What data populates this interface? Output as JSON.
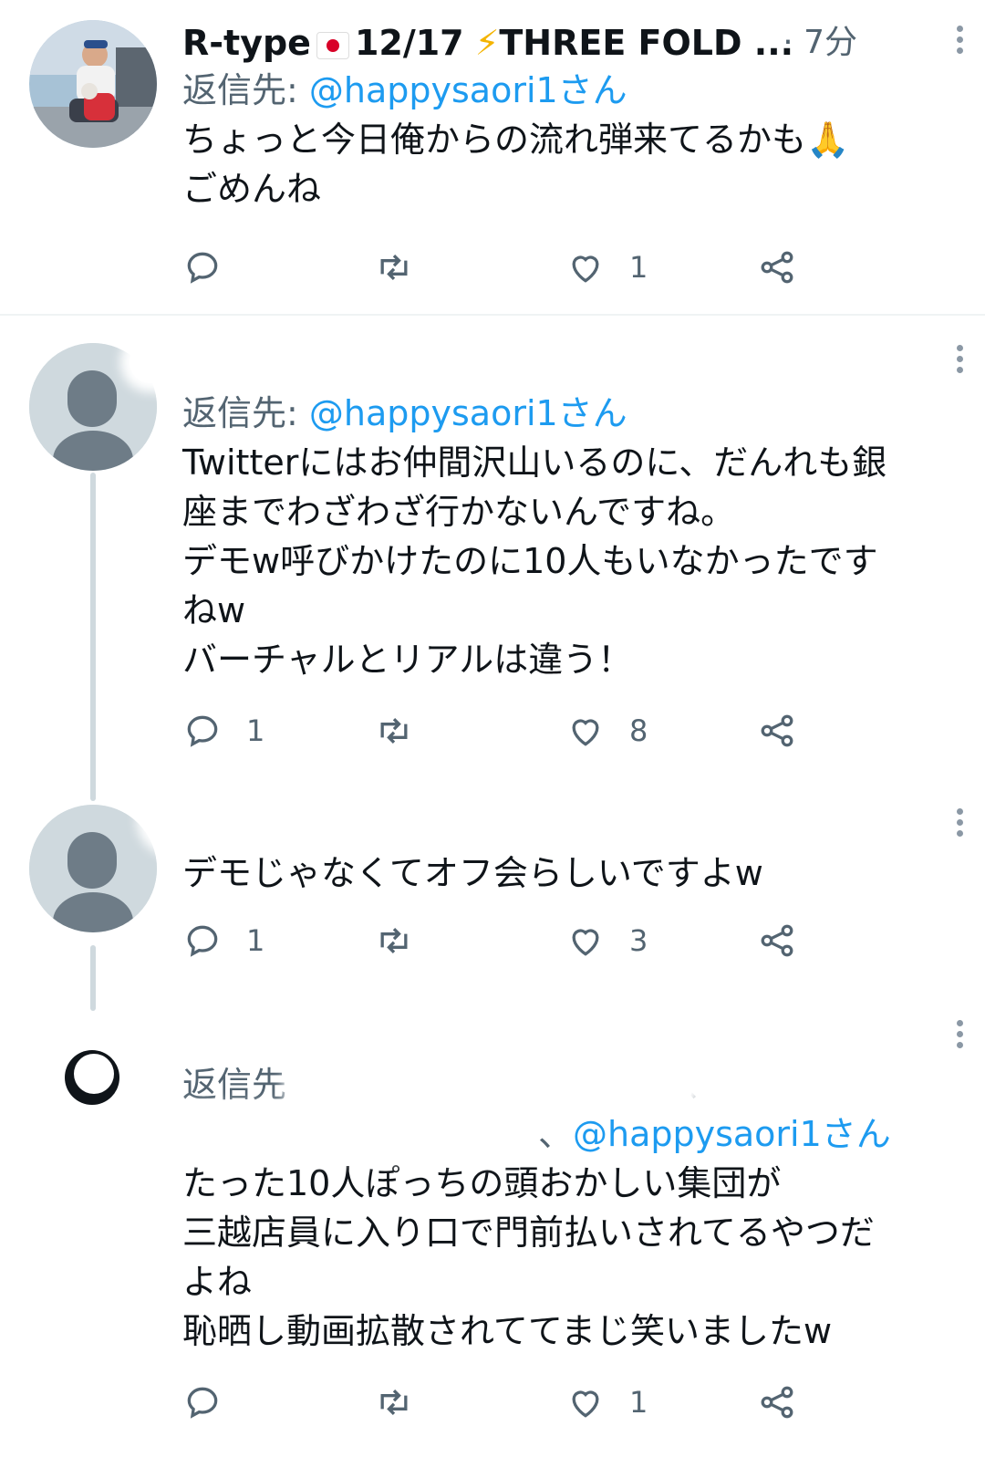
{
  "tweets": [
    {
      "name": "R-type",
      "name_suffix": "12/17",
      "name_tail": "THREE FOLD ...",
      "time": "· 7分",
      "replying_label": "返信先: ",
      "replying_to": "@happysaori1さん",
      "text": "ちょっと今日俺からの流れ弾来てるかも🙏\nごめんね",
      "reply_count": "",
      "retweet_count": "",
      "like_count": "1"
    },
    {
      "replying_label": "返信先: ",
      "replying_to": "@happysaori1さん",
      "text": "Twitterにはお仲間沢山いるのに、だんれも銀\n座までわざわざ行かないんですね。\nデモw呼びかけたのに10人もいなかったです\nねw\nバーチャルとリアルは違う！",
      "reply_count": "1",
      "retweet_count": "",
      "like_count": "8"
    },
    {
      "text": "デモじゃなくてオフ会らしいですよw",
      "reply_count": "1",
      "retweet_count": "",
      "like_count": "3"
    },
    {
      "replying_label": "返信先",
      "replying_to_separator": "、",
      "replying_to": "@happysaori1さん",
      "text": "たった10人ぽっちの頭おかしい集団が\n三越店員に入り口で門前払いされてるやつだ\nよね\n恥晒し動画拡散されててまじ笑いましたw",
      "reply_count": "",
      "retweet_count": "",
      "like_count": "1"
    }
  ],
  "icons": {
    "reply": "reply-icon",
    "retweet": "retweet-icon",
    "like": "heart-icon",
    "share": "share-icon",
    "more": "more-vertical-icon"
  },
  "colors": {
    "accent": "#1d9bf0",
    "secondary_text": "#536471",
    "thread_line": "#cfd9de"
  }
}
